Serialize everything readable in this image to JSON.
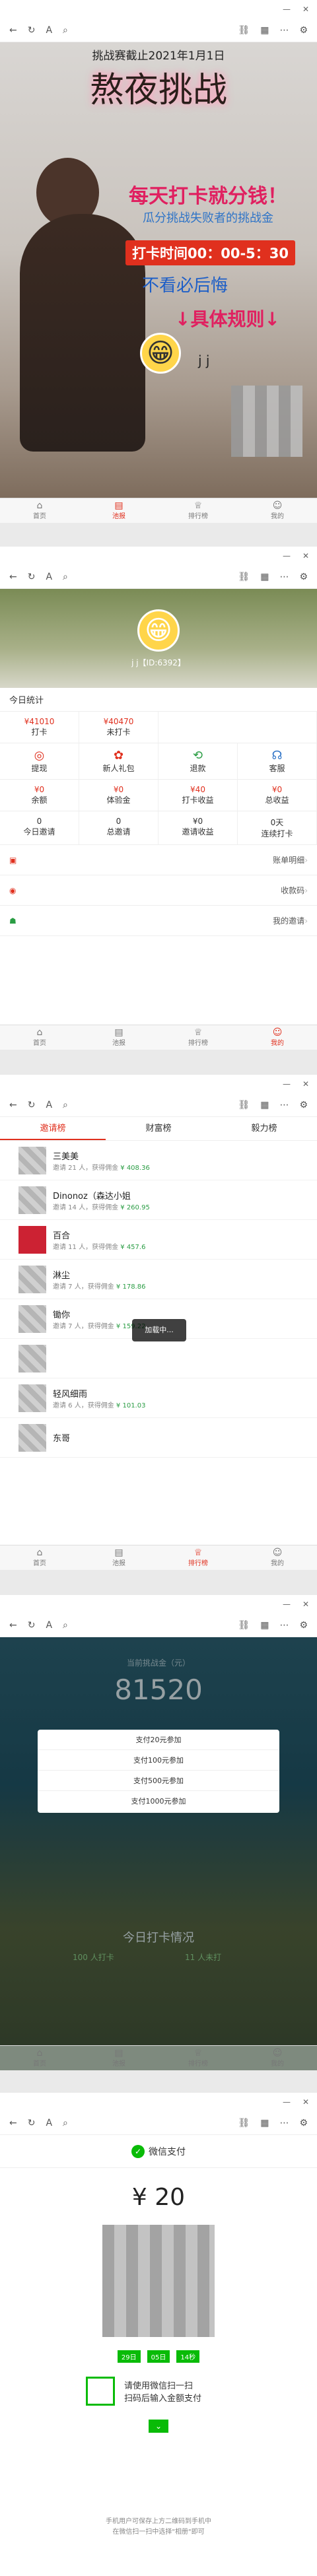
{
  "nav": {
    "home": "首页",
    "dash": "池报",
    "rank": "排行榜",
    "mine": "我的"
  },
  "browser": {
    "minimize": "—",
    "close": "✕"
  },
  "challenge": {
    "deadline": "挑战赛截止2021年1月1日",
    "title": "熬夜挑战",
    "slogan1": "每天打卡就分钱！",
    "slogan2": "瓜分挑战失败者的挑战金",
    "time": "打卡时间00：00-5：30",
    "warn": "不看必后悔",
    "rules": "↓具体规则↓",
    "jj": "j j"
  },
  "profile": {
    "name": "j j【ID:6392】",
    "section": "今日统计",
    "stat1": "¥41010",
    "stat1l": "打卡",
    "stat2": "¥40470",
    "stat2l": "未打卡",
    "acts": [
      "提现",
      "新人礼包",
      "退款",
      "客服"
    ],
    "money": [
      [
        "¥0",
        "余额"
      ],
      [
        "¥0",
        "体验金"
      ],
      [
        "¥40",
        "打卡收益"
      ],
      [
        "¥0",
        "总收益"
      ]
    ],
    "invite": [
      [
        "0",
        "今日邀请"
      ],
      [
        "0",
        "总邀请"
      ],
      [
        "¥0",
        "邀请收益"
      ],
      [
        "0天",
        "连续打卡"
      ]
    ],
    "rows": [
      "账单明细",
      "收款码",
      "我的邀请"
    ]
  },
  "ranking": {
    "tabs": [
      "邀请榜",
      "财富榜",
      "毅力榜"
    ],
    "loading": "加载中...",
    "items": [
      {
        "name": "三美美",
        "sub": "邀请 21 人，获得佣金",
        "amt": "¥ 408.36"
      },
      {
        "name": "Dinonoz（森达小姐",
        "sub": "邀请 14 人，获得佣金",
        "amt": "¥ 260.95"
      },
      {
        "name": "百合",
        "sub": "邀请 11 人，获得佣金",
        "amt": "¥ 457.6"
      },
      {
        "name": "淋尘",
        "sub": "邀请 7 人，获得佣金",
        "amt": "¥ 178.86"
      },
      {
        "name": "锄你",
        "sub": "邀请 7 人，获得佣金",
        "amt": "¥ 159.22"
      },
      {
        "name": "",
        "sub": "",
        "amt": ""
      },
      {
        "name": "轻风细雨",
        "sub": "邀请 6 人，获得佣金",
        "amt": "¥ 101.03"
      },
      {
        "name": "东哥",
        "sub": "",
        "amt": ""
      }
    ]
  },
  "pool": {
    "top": "当前挑战金（元）",
    "amount": "81520",
    "modal": [
      "支付20元参加",
      "支付100元参加",
      "支付500元参加",
      "支付1000元参加"
    ],
    "today": "今日打卡情况",
    "ok": "100 人打卡",
    "fail": "11 人未打"
  },
  "wechat": {
    "brand": "微信支付",
    "amount": "¥ 20",
    "tags": [
      "29日",
      "05日",
      "14秒"
    ],
    "scan1": "请使用微信扫一扫",
    "scan2": "扫码后输入金额支付",
    "foot1": "手机用户可保存上方二维码到手机中",
    "foot2": "在微信扫一扫中选择\"相册\"即可"
  }
}
